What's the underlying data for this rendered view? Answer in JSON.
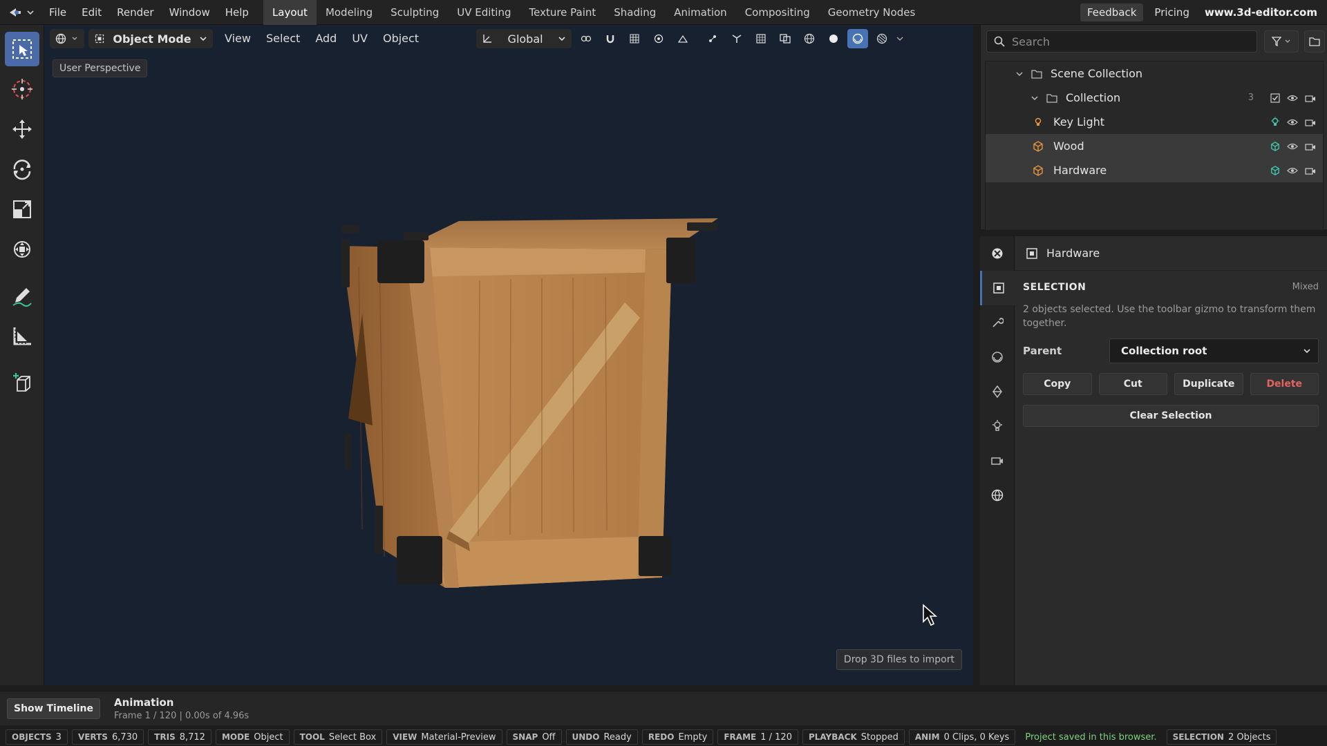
{
  "topbar": {
    "menus": [
      "File",
      "Edit",
      "Render",
      "Window",
      "Help"
    ],
    "workspaces": [
      "Layout",
      "Modeling",
      "Sculpting",
      "UV Editing",
      "Texture Paint",
      "Shading",
      "Animation",
      "Compositing",
      "Geometry Nodes"
    ],
    "active_workspace": "Layout",
    "feedback": "Feedback",
    "pricing": "Pricing",
    "site": "www.3d-editor.com"
  },
  "viewport": {
    "mode": "Object Mode",
    "menus": [
      "View",
      "Select",
      "Add",
      "UV",
      "Object"
    ],
    "orientation": "Global",
    "perspective": "User Perspective",
    "drop_hint": "Drop 3D files to import"
  },
  "outliner": {
    "search_placeholder": "Search",
    "scene_collection": "Scene Collection",
    "collection": "Collection",
    "collection_count": "3",
    "objects": [
      {
        "name": "Key Light",
        "icon": "light-icon"
      },
      {
        "name": "Wood",
        "icon": "mesh-icon"
      },
      {
        "name": "Hardware",
        "icon": "mesh-icon"
      }
    ]
  },
  "properties": {
    "object_name": "Hardware",
    "section_title": "SELECTION",
    "section_state": "Mixed",
    "description": "2 objects selected. Use the toolbar gizmo to transform them together.",
    "parent_label": "Parent",
    "parent_value": "Collection root",
    "buttons": {
      "copy": "Copy",
      "cut": "Cut",
      "duplicate": "Duplicate",
      "delete": "Delete",
      "clear": "Clear Selection"
    }
  },
  "timeline": {
    "show_label": "Show Timeline",
    "title": "Animation",
    "frame_info": "Frame 1 / 120 | 0.00s of 4.96s"
  },
  "status": {
    "objects": {
      "k": "OBJECTS",
      "v": "3"
    },
    "verts": {
      "k": "VERTS",
      "v": "6,730"
    },
    "tris": {
      "k": "TRIS",
      "v": "8,712"
    },
    "mode": {
      "k": "MODE",
      "v": "Object"
    },
    "tool": {
      "k": "TOOL",
      "v": "Select Box"
    },
    "view": {
      "k": "VIEW",
      "v": "Material-Preview"
    },
    "snap": {
      "k": "SNAP",
      "v": "Off"
    },
    "undo": {
      "k": "UNDO",
      "v": "Ready"
    },
    "redo": {
      "k": "REDO",
      "v": "Empty"
    },
    "frame": {
      "k": "FRAME",
      "v": "1 / 120"
    },
    "playback": {
      "k": "PLAYBACK",
      "v": "Stopped"
    },
    "anim": {
      "k": "ANIM",
      "v": "0 Clips, 0 Keys"
    },
    "saved": "Project saved in this browser.",
    "selection": {
      "k": "SELECTION",
      "v": "2 Objects"
    }
  },
  "colors": {
    "accent": "#4772b3",
    "viewport_bg": "#172130",
    "danger": "#e06565",
    "ok": "#7fd17f",
    "mesh_icon": "#e8953a",
    "visibility_teal": "#3fc7b0"
  }
}
